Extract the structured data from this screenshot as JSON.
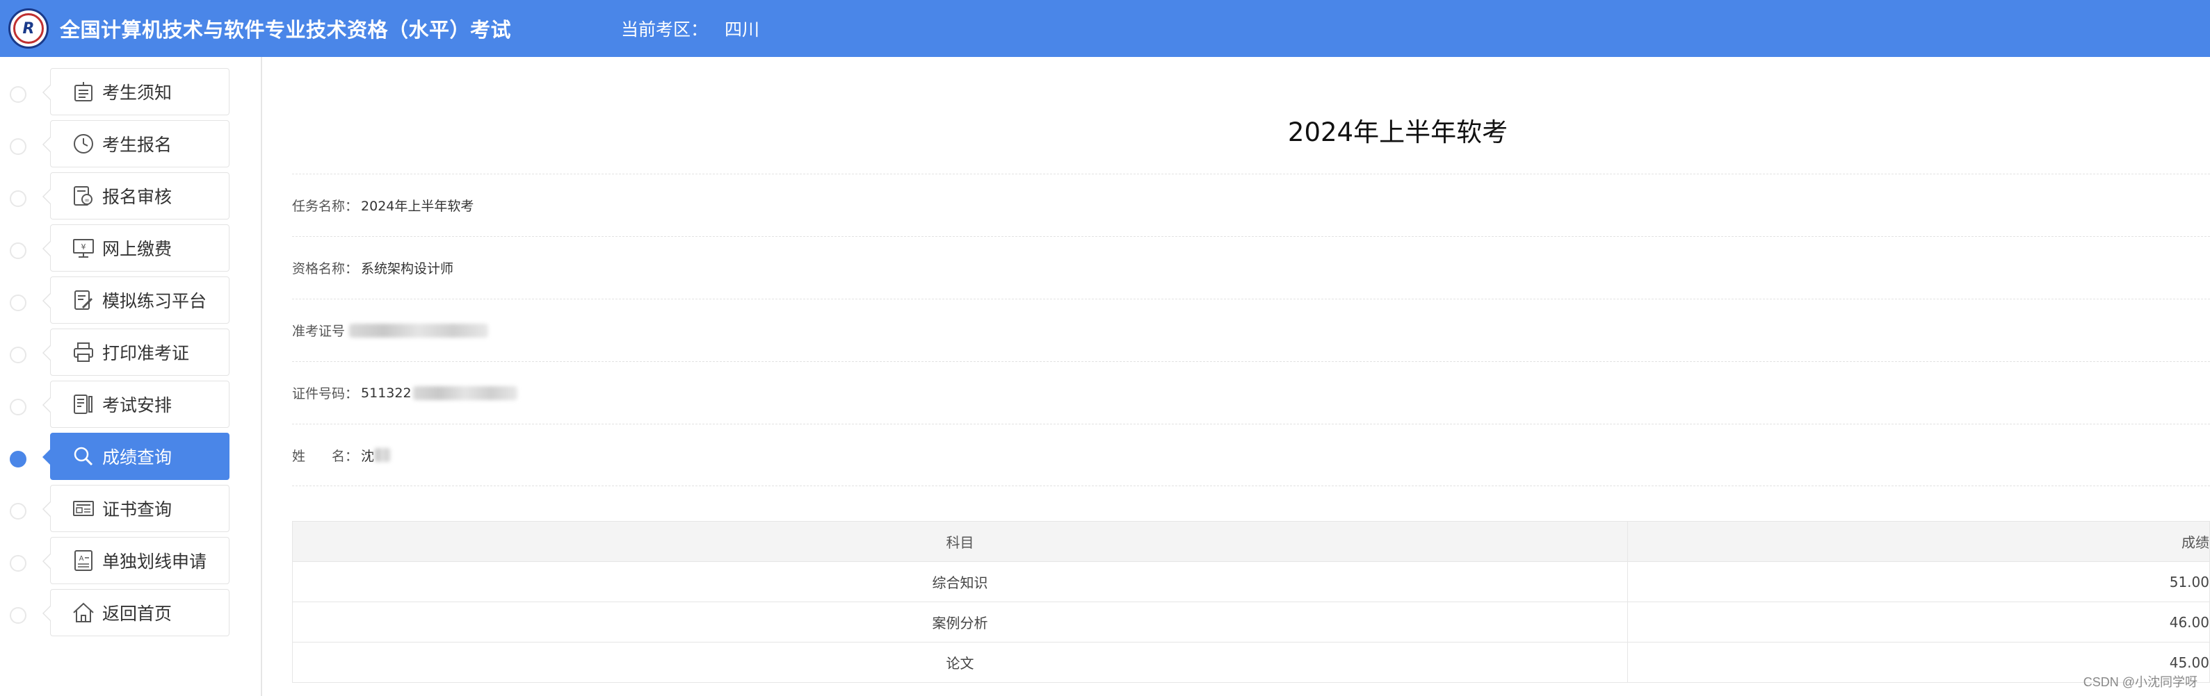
{
  "header": {
    "title": "全国计算机技术与软件专业技术资格（水平）考试",
    "region_label": "当前考区：",
    "region_value": "四川",
    "bg_color": "#4a86e8"
  },
  "sidebar": {
    "items": [
      {
        "label": "考生须知",
        "icon": "notice-icon",
        "active": false
      },
      {
        "label": "考生报名",
        "icon": "clock-icon",
        "active": false
      },
      {
        "label": "报名审核",
        "icon": "audit-icon",
        "active": false
      },
      {
        "label": "网上缴费",
        "icon": "payment-monitor-icon",
        "active": false
      },
      {
        "label": "模拟练习平台",
        "icon": "practice-icon",
        "active": false
      },
      {
        "label": "打印准考证",
        "icon": "printer-icon",
        "active": false
      },
      {
        "label": "考试安排",
        "icon": "schedule-icon",
        "active": false
      },
      {
        "label": "成绩查询",
        "icon": "search-icon",
        "active": true
      },
      {
        "label": "证书查询",
        "icon": "certificate-icon",
        "active": false
      },
      {
        "label": "单独划线申请",
        "icon": "application-form-icon",
        "active": false
      },
      {
        "label": "返回首页",
        "icon": "home-icon",
        "active": false
      }
    ]
  },
  "main": {
    "page_title": "2024年上半年软考",
    "info": {
      "task_label": "任务名称：",
      "task_value": "2024年上半年软考",
      "qual_label": "资格名称：",
      "qual_value": "系统架构设计师",
      "ticket_label": "准考证号",
      "id_label": "证件号码：",
      "id_value": "511322",
      "name_label": "姓　　名：",
      "name_value": "沈"
    },
    "table": {
      "headers": [
        "科目",
        "成绩"
      ],
      "rows": [
        {
          "subject": "综合知识",
          "score": "51.00"
        },
        {
          "subject": "案例分析",
          "score": "46.00"
        },
        {
          "subject": "论文",
          "score": "45.00"
        }
      ]
    }
  },
  "watermark": "CSDN @小沈同学呀"
}
